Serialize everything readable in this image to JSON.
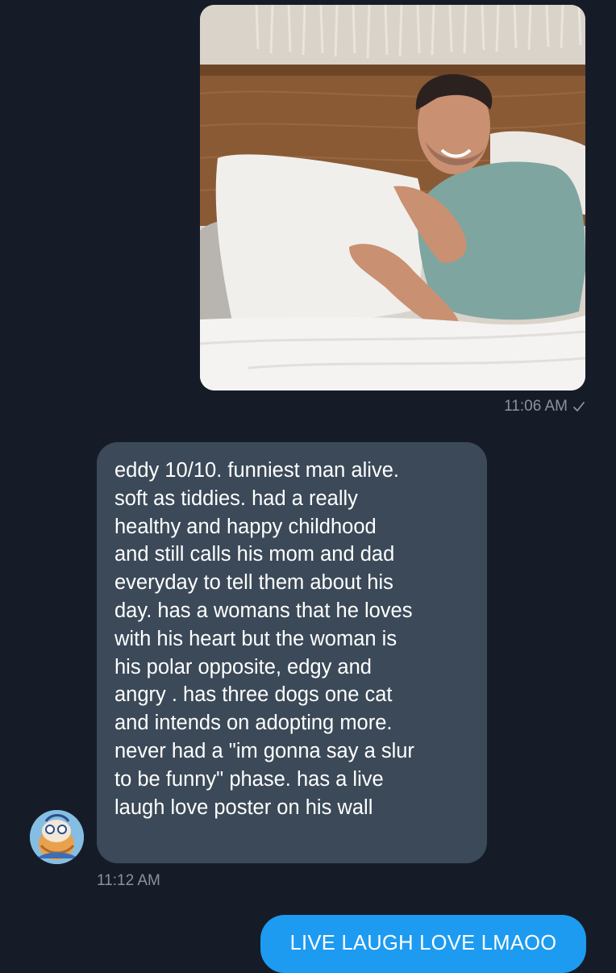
{
  "conversation": {
    "sent_image": {
      "alt": "photo",
      "timestamp": "11:06 AM",
      "status_icon": "check-icon"
    },
    "received_message": {
      "text": "eddy 10/10. funniest man alive.\nsoft as tiddies. had a really\nhealthy and happy childhood\nand still calls his mom and dad\neveryday to tell them about his\nday. has a womans that he loves\nwith his heart but the woman is\nhis polar opposite, edgy and\nangry . has three dogs one cat\nand intends on adopting more.\nnever had a \"im gonna say a slur\nto be funny\" phase. has a live\nlaugh love poster on his wall",
      "timestamp": "11:12 AM",
      "avatar_icon": "avatar"
    },
    "sent_message": {
      "text": "LIVE LAUGH LOVE LMAOO"
    }
  },
  "colors": {
    "background": "#151c28",
    "received_bubble": "#3b4958",
    "sent_bubble": "#1d9bf0",
    "timestamp": "#8a929f"
  }
}
